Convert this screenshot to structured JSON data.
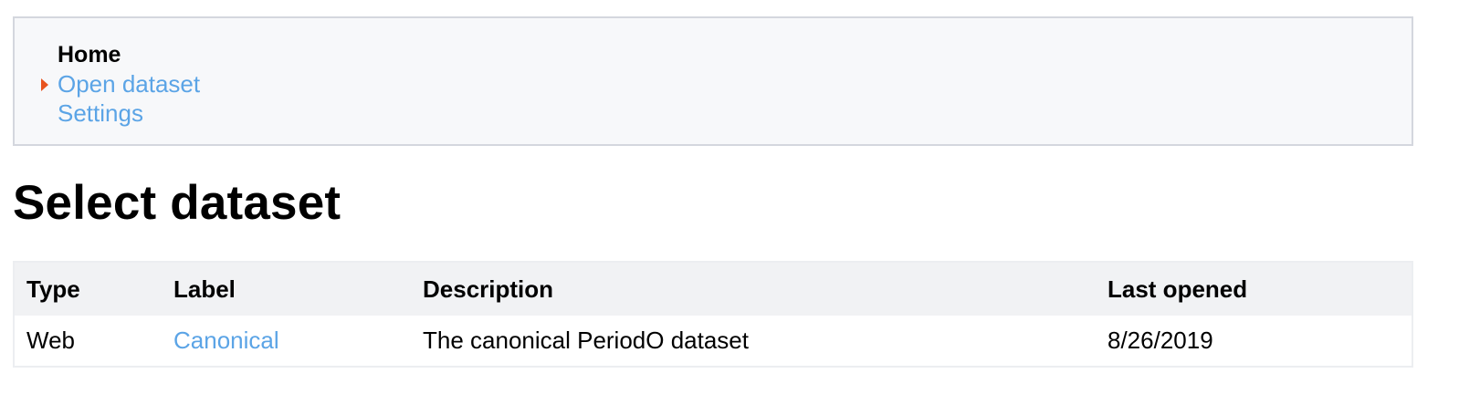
{
  "nav": {
    "items": [
      {
        "label": "Home",
        "current": true
      },
      {
        "label": "Open dataset",
        "current": false
      },
      {
        "label": "Settings",
        "current": false
      }
    ],
    "marker_color": "#e8541f",
    "link_color": "#5ba4e6"
  },
  "page": {
    "title": "Select dataset"
  },
  "table": {
    "headers": {
      "type": "Type",
      "label": "Label",
      "description": "Description",
      "last_opened": "Last opened"
    },
    "rows": [
      {
        "type": "Web",
        "label": "Canonical",
        "description": "The canonical PeriodO dataset",
        "last_opened": "8/26/2019"
      }
    ]
  }
}
